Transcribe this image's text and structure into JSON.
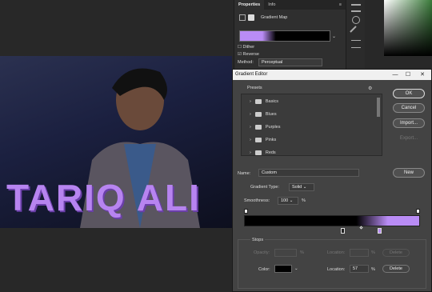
{
  "properties": {
    "tabs": [
      "Properties",
      "Info"
    ],
    "layer_type": "Gradient Map",
    "dither_label": "Dither",
    "reverse_label": "Reverse",
    "method_label": "Method:",
    "method_value": "Perceptual"
  },
  "canvas": {
    "overlay_text": "TARIQ ALI"
  },
  "dialog": {
    "title": "Gradient Editor",
    "presets_label": "Presets",
    "presets": [
      "Basics",
      "Blues",
      "Purples",
      "Pinks",
      "Reds"
    ],
    "buttons": {
      "ok": "OK",
      "cancel": "Cancel",
      "import": "Import...",
      "export": "Export...",
      "new": "New"
    },
    "name_label": "Name:",
    "name_value": "Custom",
    "gradient_type_label": "Gradient Type:",
    "gradient_type_value": "Solid",
    "smoothness_label": "Smoothness:",
    "smoothness_value": "100",
    "smoothness_unit": "%",
    "stops": {
      "label": "Stops",
      "opacity_label": "Opacity:",
      "opacity_value": "",
      "opacity_unit": "%",
      "location_label": "Location:",
      "location_top_value": "",
      "location_unit": "%",
      "delete_label": "Delete",
      "color_label": "Color:",
      "location_bottom_value": "57"
    },
    "gradient_colors": {
      "start": "#000000",
      "mid": "#000000",
      "end": "#b98cf5"
    }
  }
}
